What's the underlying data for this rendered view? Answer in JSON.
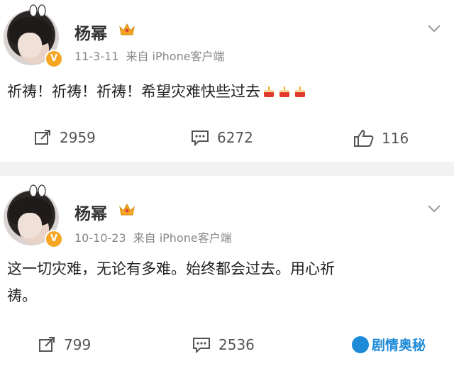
{
  "posts": [
    {
      "user": "杨幂",
      "date": "11-3-11",
      "source": "来自 iPhone客户端",
      "content": "祈祷！祈祷！祈祷！希望灾难快些过去",
      "emojis": [
        "cake-icon",
        "cake-icon",
        "cake-icon"
      ],
      "repost_count": "2959",
      "comment_count": "6272",
      "like_count": "116"
    },
    {
      "user": "杨幂",
      "date": "10-10-23",
      "source": "来自 iPhone客户端",
      "content_line1": "这一切灾难，无论有多难。始终都会过去。用心祈",
      "content_line2": "祷。",
      "repost_count": "799",
      "comment_count": "2536"
    }
  ],
  "watermark": "剧情奥秘",
  "colors": {
    "accent": "#f6a623",
    "divider": "#f2f2f2",
    "watermark": "#1e8bd9"
  }
}
